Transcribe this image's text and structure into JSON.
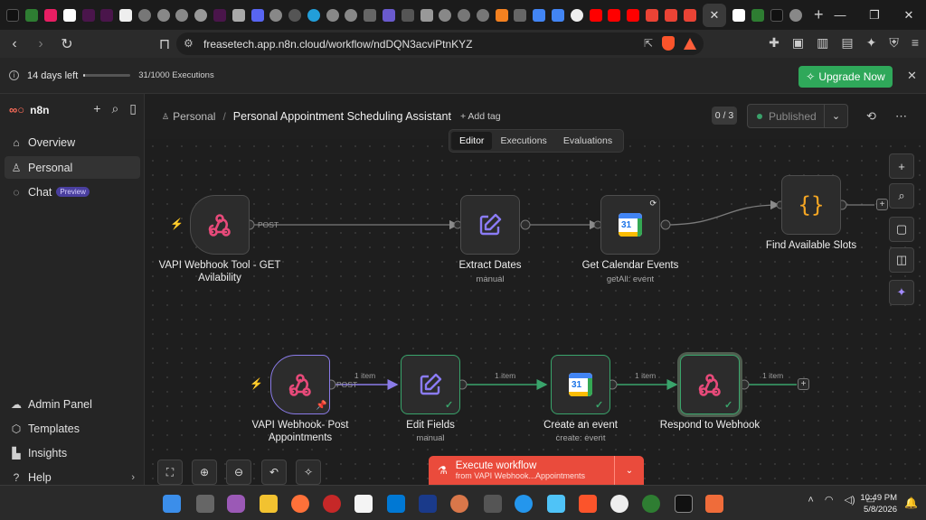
{
  "browser": {
    "url": "freasetech.app.n8n.cloud/workflow/ndDQN3acviPtnKYZ",
    "active_tab_close": "✕",
    "new_tab": "+"
  },
  "banner": {
    "days_left": "14 days left",
    "executions": "31/1000 Executions",
    "executions_used_fraction": 0.031,
    "upgrade_label": "Upgrade Now",
    "close": "✕"
  },
  "sidebar": {
    "brand": "n8n",
    "items": [
      {
        "label": "Overview",
        "icon": "home-icon"
      },
      {
        "label": "Personal",
        "icon": "user-icon"
      },
      {
        "label": "Chat",
        "icon": "chat-icon",
        "badge": "Preview"
      }
    ],
    "bottom_items": [
      {
        "label": "Admin Panel",
        "icon": "cloud-icon"
      },
      {
        "label": "Templates",
        "icon": "box-icon"
      },
      {
        "label": "Insights",
        "icon": "bar-chart-icon"
      },
      {
        "label": "Help",
        "icon": "help-icon"
      }
    ]
  },
  "header": {
    "project": "Personal",
    "workflow_name": "Personal Appointment Scheduling Assistant",
    "add_tag": "+ Add tag",
    "counter": "0 / 3",
    "status": "Published",
    "tabs": [
      "Editor",
      "Executions",
      "Evaluations"
    ],
    "active_tab": "Editor"
  },
  "nodes": [
    {
      "id": "vapi-get",
      "label": "VAPI Webhook Tool - GET Avilability",
      "sub": ""
    },
    {
      "id": "extract-dates",
      "label": "Extract Dates",
      "sub": "manual"
    },
    {
      "id": "get-cal",
      "label": "Get Calendar Events",
      "sub": "getAll: event"
    },
    {
      "id": "find-slots",
      "label": "Find Available Slots",
      "sub": ""
    },
    {
      "id": "vapi-post",
      "label": "VAPI Webhook- Post Appointments",
      "sub": ""
    },
    {
      "id": "edit-fields",
      "label": "Edit Fields",
      "sub": "manual"
    },
    {
      "id": "create-event",
      "label": "Create an event",
      "sub": "create: event"
    },
    {
      "id": "respond",
      "label": "Respond to Webhook",
      "sub": ""
    }
  ],
  "edge_labels": {
    "post1": "POST",
    "post2": "POST",
    "item1": "1 item",
    "item2": "1 item",
    "item3": "1 item",
    "item4": "1 item"
  },
  "calendar_day": "31",
  "execute": {
    "label": "Execute workflow",
    "sub": "from VAPI Webhook...Appointments"
  },
  "taskbar": {
    "time": "10:49 PM",
    "date": "5/8/2026"
  },
  "colors": {
    "accent": "#ff6d5a",
    "success": "#39a46b",
    "upgrade": "#2fa85a",
    "execute": "#ea4b3c",
    "pinned": "#8a7be8"
  }
}
